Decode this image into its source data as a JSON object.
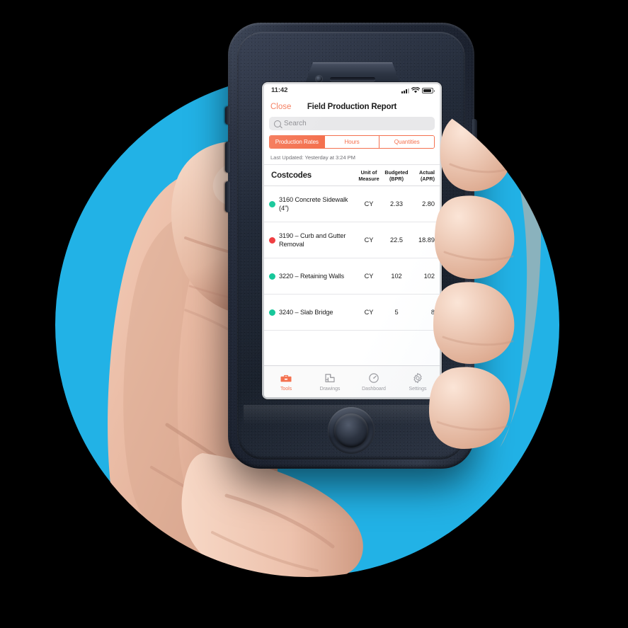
{
  "scene": {
    "backdrop_color": "#22b2e6",
    "background_color": "#000000",
    "description": "hand-holding-phone"
  },
  "device": {
    "case_color": "#242b39",
    "icons": {
      "speaker": "speaker-grille-icon",
      "camera": "front-camera-icon",
      "home": "home-button-icon"
    }
  },
  "status_bar": {
    "time": "11:42",
    "cellular": "signal-bars-icon",
    "wifi": "wifi-icon",
    "battery": "battery-icon"
  },
  "nav": {
    "close_label": "Close",
    "title": "Field Production Report"
  },
  "search": {
    "placeholder": "Search",
    "icon": "search-icon",
    "value": ""
  },
  "segmented": {
    "active_index": 0,
    "accent_color": "#f4714f",
    "tabs": [
      {
        "label": "Production Rates"
      },
      {
        "label": "Hours"
      },
      {
        "label": "Quantities"
      }
    ]
  },
  "meta": {
    "last_updated": "Last Updated: Yesterday at 3:24 PM"
  },
  "table": {
    "headers": {
      "costcodes": "Costcodes",
      "unit_of_measure": "Unit of\nMeasure",
      "unit_of_measure_l1": "Unit of",
      "unit_of_measure_l2": "Measure",
      "budgeted_l1": "Budgeted",
      "budgeted_l2": "(BPR)",
      "actual_l1": "Actual",
      "actual_l2": "(APR)"
    },
    "rows": [
      {
        "status_color": "#17c79a",
        "name": "3160 Concrete Sidewalk (4”)",
        "unit": "CY",
        "budgeted": "2.33",
        "actual": "2.80"
      },
      {
        "status_color": "#ef3e42",
        "name": "3190 – Curb and Gutter Removal",
        "unit": "CY",
        "budgeted": "22.5",
        "actual": "18.89"
      },
      {
        "status_color": "#17c79a",
        "name": "3220 – Retaining Walls",
        "unit": "CY",
        "budgeted": "102",
        "actual": "102"
      },
      {
        "status_color": "#17c79a",
        "name": "3240 – Slab Bridge",
        "unit": "CY",
        "budgeted": "5",
        "actual": "8"
      }
    ]
  },
  "tab_bar": {
    "active_index": 0,
    "active_color": "#f4714f",
    "inactive_color": "#9a9a9f",
    "items": [
      {
        "label": "Tools",
        "icon": "toolbox-icon"
      },
      {
        "label": "Drawings",
        "icon": "blueprint-icon"
      },
      {
        "label": "Dashboard",
        "icon": "gauge-icon"
      },
      {
        "label": "Settings",
        "icon": "gear-icon"
      }
    ]
  }
}
